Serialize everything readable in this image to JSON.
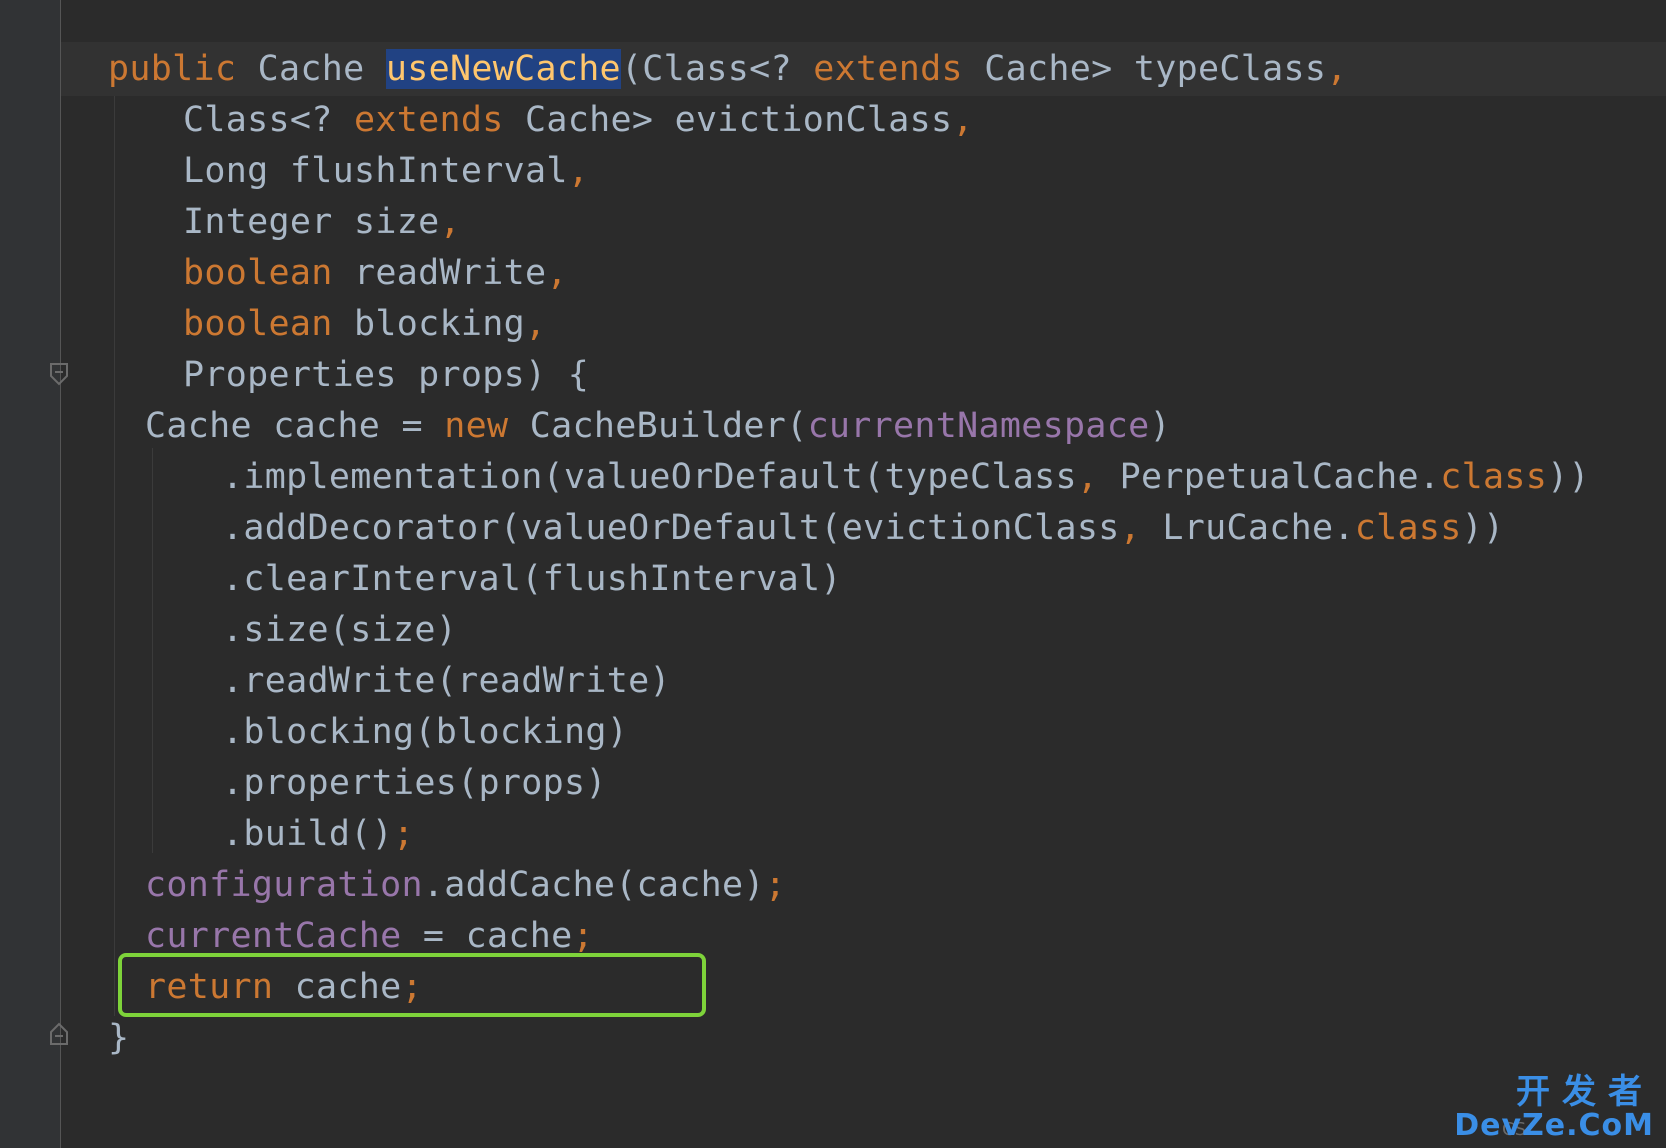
{
  "editor": {
    "lines": [
      {
        "tokens": [
          [
            "kw",
            "public"
          ],
          [
            "t",
            " Cache "
          ],
          [
            "sel",
            "useNewCache"
          ],
          [
            "t",
            "(Class<? "
          ],
          [
            "kw",
            "extends"
          ],
          [
            "t",
            " Cache> typeClass"
          ],
          [
            "punc",
            ","
          ]
        ]
      },
      {
        "tokens": [
          [
            "t",
            "Class<? "
          ],
          [
            "kw",
            "extends"
          ],
          [
            "t",
            " Cache> evictionClass"
          ],
          [
            "punc",
            ","
          ]
        ]
      },
      {
        "tokens": [
          [
            "t",
            "Long flushInterval"
          ],
          [
            "punc",
            ","
          ]
        ]
      },
      {
        "tokens": [
          [
            "t",
            "Integer size"
          ],
          [
            "punc",
            ","
          ]
        ]
      },
      {
        "tokens": [
          [
            "kw",
            "boolean"
          ],
          [
            "t",
            " readWrite"
          ],
          [
            "punc",
            ","
          ]
        ]
      },
      {
        "tokens": [
          [
            "kw",
            "boolean"
          ],
          [
            "t",
            " blocking"
          ],
          [
            "punc",
            ","
          ]
        ]
      },
      {
        "tokens": [
          [
            "t",
            "Properties props) {"
          ]
        ]
      },
      {
        "tokens": [
          [
            "t",
            "Cache cache = "
          ],
          [
            "kw",
            "new"
          ],
          [
            "t",
            " CacheBuilder("
          ],
          [
            "field",
            "currentNamespace"
          ],
          [
            "t",
            ")"
          ]
        ]
      },
      {
        "tokens": [
          [
            "t",
            ".implementation(valueOrDefault(typeClass"
          ],
          [
            "punc",
            ","
          ],
          [
            "t",
            " PerpetualCache."
          ],
          [
            "kw",
            "class"
          ],
          [
            "t",
            "))"
          ]
        ]
      },
      {
        "tokens": [
          [
            "t",
            ".addDecorator(valueOrDefault(evictionClass"
          ],
          [
            "punc",
            ","
          ],
          [
            "t",
            " LruCache."
          ],
          [
            "kw",
            "class"
          ],
          [
            "t",
            "))"
          ]
        ]
      },
      {
        "tokens": [
          [
            "t",
            ".clearInterval(flushInterval)"
          ]
        ]
      },
      {
        "tokens": [
          [
            "t",
            ".size(size)"
          ]
        ]
      },
      {
        "tokens": [
          [
            "t",
            ".readWrite(readWrite)"
          ]
        ]
      },
      {
        "tokens": [
          [
            "t",
            ".blocking(blocking)"
          ]
        ]
      },
      {
        "tokens": [
          [
            "t",
            ".properties(props)"
          ]
        ]
      },
      {
        "tokens": [
          [
            "t",
            ".build()"
          ],
          [
            "punc",
            ";"
          ]
        ]
      },
      {
        "tokens": [
          [
            "field",
            "configuration"
          ],
          [
            "t",
            ".addCache(cache)"
          ],
          [
            "punc",
            ";"
          ]
        ]
      },
      {
        "tokens": [
          [
            "field",
            "currentCache"
          ],
          [
            "t",
            " = cache"
          ],
          [
            "punc",
            ";"
          ]
        ]
      },
      {
        "tokens": [
          [
            "kw",
            "return"
          ],
          [
            "t",
            " cache"
          ],
          [
            "punc",
            ";"
          ]
        ]
      },
      {
        "tokens": [
          [
            "t",
            "}"
          ]
        ]
      }
    ]
  },
  "watermark": {
    "prefix": "CS",
    "chinese": "开发者",
    "english": "DevZe.CoM"
  }
}
